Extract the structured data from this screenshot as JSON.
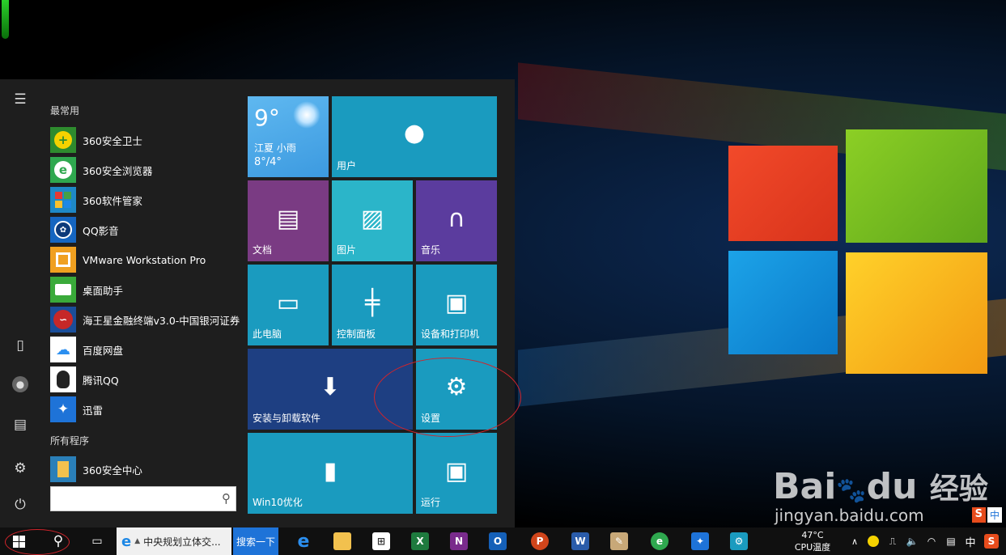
{
  "start_menu": {
    "most_used_header": "最常用",
    "all_programs_header": "所有程序",
    "apps": [
      {
        "label": "360安全卫士",
        "icon": "360-guard-icon",
        "color": "#2e8b2e"
      },
      {
        "label": "360安全浏览器",
        "icon": "360-browser-icon",
        "color": "#2fa84f"
      },
      {
        "label": "360软件管家",
        "icon": "360-software-manager-icon",
        "color": "#1e88c6"
      },
      {
        "label": "QQ影音",
        "icon": "qq-player-icon",
        "color": "#1565c0"
      },
      {
        "label": "VMware Workstation Pro",
        "icon": "vmware-icon",
        "color": "#f0a020"
      },
      {
        "label": "桌面助手",
        "icon": "desktop-assistant-icon",
        "color": "#3aaa3a"
      },
      {
        "label": "海王星金融终端v3.0-中国银河证券",
        "icon": "neptune-finance-icon",
        "color": "#c62828"
      },
      {
        "label": "百度网盘",
        "icon": "baidu-netdisk-icon",
        "color": "#2b8ff0"
      },
      {
        "label": "腾讯QQ",
        "icon": "qq-icon",
        "color": "#222"
      },
      {
        "label": "迅雷",
        "icon": "xunlei-icon",
        "color": "#1e73d8"
      }
    ],
    "all_programs_first": {
      "label": "360安全中心",
      "icon": "folder-icon",
      "color": "#f2c14e"
    },
    "search_placeholder": ""
  },
  "tiles": {
    "weather": {
      "temp": "9°",
      "location": "江夏 小雨",
      "range": "8°/4°"
    },
    "user": "用户",
    "documents": "文档",
    "pictures": "图片",
    "music": "音乐",
    "this_pc": "此电脑",
    "control_panel": "控制面板",
    "devices_printers": "设备和打印机",
    "install_uninstall": "安装与卸载软件",
    "settings": "设置",
    "win10_optimize": "Win10优化",
    "run": "运行"
  },
  "taskbar": {
    "ie_window_title": "中央规划立体交...",
    "search_button": "搜索一下",
    "cpu_temp": "47°C",
    "cpu_label": "CPU温度",
    "ime": "中"
  },
  "watermark": {
    "brand": "Bai",
    "brand2": "du",
    "product": "经验",
    "url": "jingyan.baidu.com",
    "ime_badge": "中",
    "sogou": "S"
  },
  "colors": {
    "tile_blue": "#1a9bbf",
    "tile_purple": "#7a3b83",
    "tile_violet": "#5b3c9e",
    "tile_navy": "#1e3f82",
    "weather_sky": "#4aa9e8",
    "annotation_red": "#d2242b"
  }
}
